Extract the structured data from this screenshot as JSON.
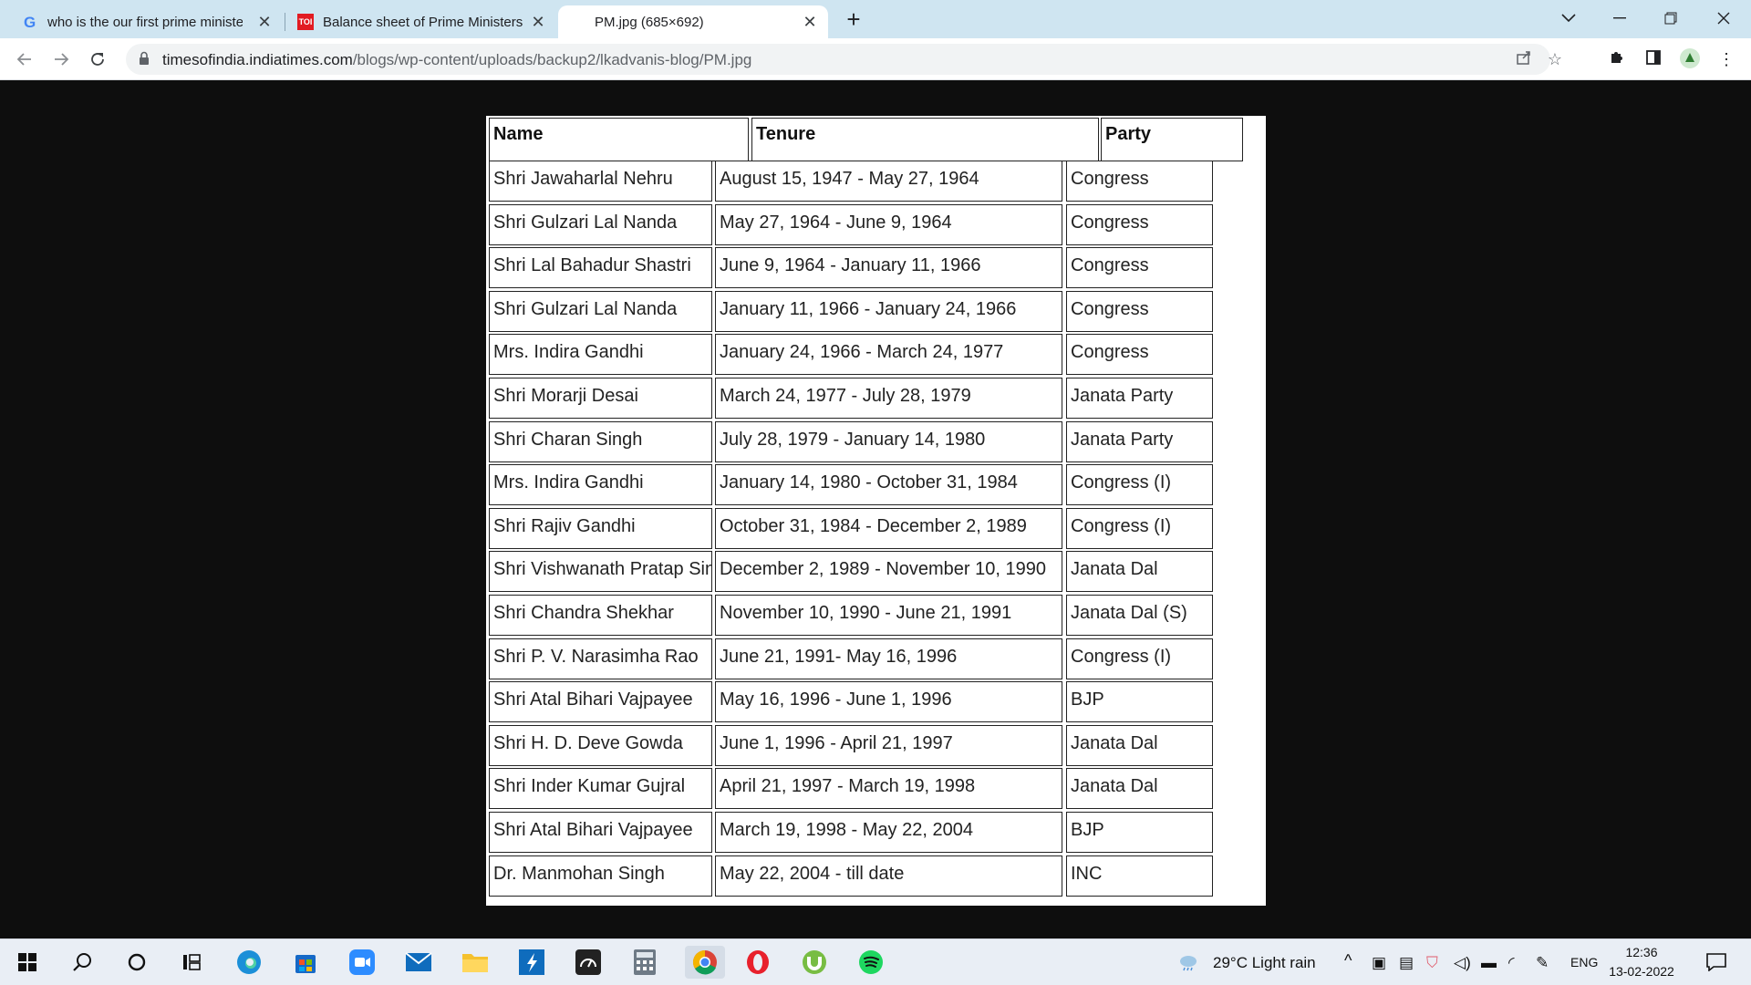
{
  "browser": {
    "tabs": [
      {
        "title": "who is the our first prime minister - Google Search",
        "favicon": "google-icon",
        "active": false
      },
      {
        "title": "Balance sheet of Prime Ministers",
        "favicon": "toi-icon",
        "favicon_text": "TOI",
        "active": false
      },
      {
        "title": "PM.jpg (685×692)",
        "favicon": "image-icon",
        "active": true
      }
    ],
    "url_host": "timesofindia.indiatimes.com",
    "url_path": "/blogs/wp-content/uploads/backup2/lkadvanis-blog/PM.jpg"
  },
  "table": {
    "headers": {
      "name": "Name",
      "tenure": "Tenure",
      "party": "Party"
    },
    "rows": [
      {
        "name": "Shri Jawaharlal Nehru",
        "tenure": "August 15, 1947 - May 27, 1964",
        "party": "Congress"
      },
      {
        "name": "Shri Gulzari Lal Nanda",
        "tenure": "May 27, 1964 - June 9, 1964",
        "party": "Congress"
      },
      {
        "name": "Shri Lal Bahadur Shastri",
        "tenure": "June 9, 1964 - January 11, 1966",
        "party": "Congress"
      },
      {
        "name": "Shri Gulzari Lal Nanda",
        "tenure": "January 11, 1966 - January 24, 1966",
        "party": "Congress"
      },
      {
        "name": "Mrs. Indira Gandhi",
        "tenure": "January 24, 1966 - March 24, 1977",
        "party": "Congress"
      },
      {
        "name": "Shri Morarji Desai",
        "tenure": "March 24, 1977 - July 28, 1979",
        "party": "Janata Party"
      },
      {
        "name": "Shri Charan Singh",
        "tenure": "July 28, 1979 - January 14, 1980",
        "party": "Janata Party"
      },
      {
        "name": "Mrs. Indira Gandhi",
        "tenure": "January 14, 1980 - October 31, 1984",
        "party": "Congress (I)"
      },
      {
        "name": "Shri Rajiv Gandhi",
        "tenure": "October 31, 1984 - December 2, 1989",
        "party": "Congress (I)"
      },
      {
        "name": "Shri Vishwanath Pratap Singh",
        "tenure": "December 2, 1989 - November 10, 1990",
        "party": "Janata Dal"
      },
      {
        "name": "Shri Chandra Shekhar",
        "tenure": "November 10, 1990 - June 21, 1991",
        "party": "Janata Dal (S)"
      },
      {
        "name": "Shri P. V. Narasimha Rao",
        "tenure": "June 21, 1991- May 16, 1996",
        "party": "Congress (I)"
      },
      {
        "name": "Shri Atal Bihari Vajpayee",
        "tenure": "May 16, 1996 - June 1, 1996",
        "party": "BJP"
      },
      {
        "name": "Shri H. D. Deve Gowda",
        "tenure": "June 1, 1996 - April 21, 1997",
        "party": "Janata Dal"
      },
      {
        "name": "Shri Inder Kumar Gujral",
        "tenure": "April 21, 1997 - March 19, 1998",
        "party": "Janata Dal"
      },
      {
        "name": "Shri Atal Bihari Vajpayee",
        "tenure": "March 19, 1998 - May 22, 2004",
        "party": "BJP"
      },
      {
        "name": "Dr. Manmohan Singh",
        "tenure": "May 22, 2004 - till date",
        "party": "INC"
      }
    ]
  },
  "taskbar": {
    "weather": "29°C  Light rain",
    "language": "ENG",
    "time": "12:36",
    "date": "13-02-2022"
  }
}
